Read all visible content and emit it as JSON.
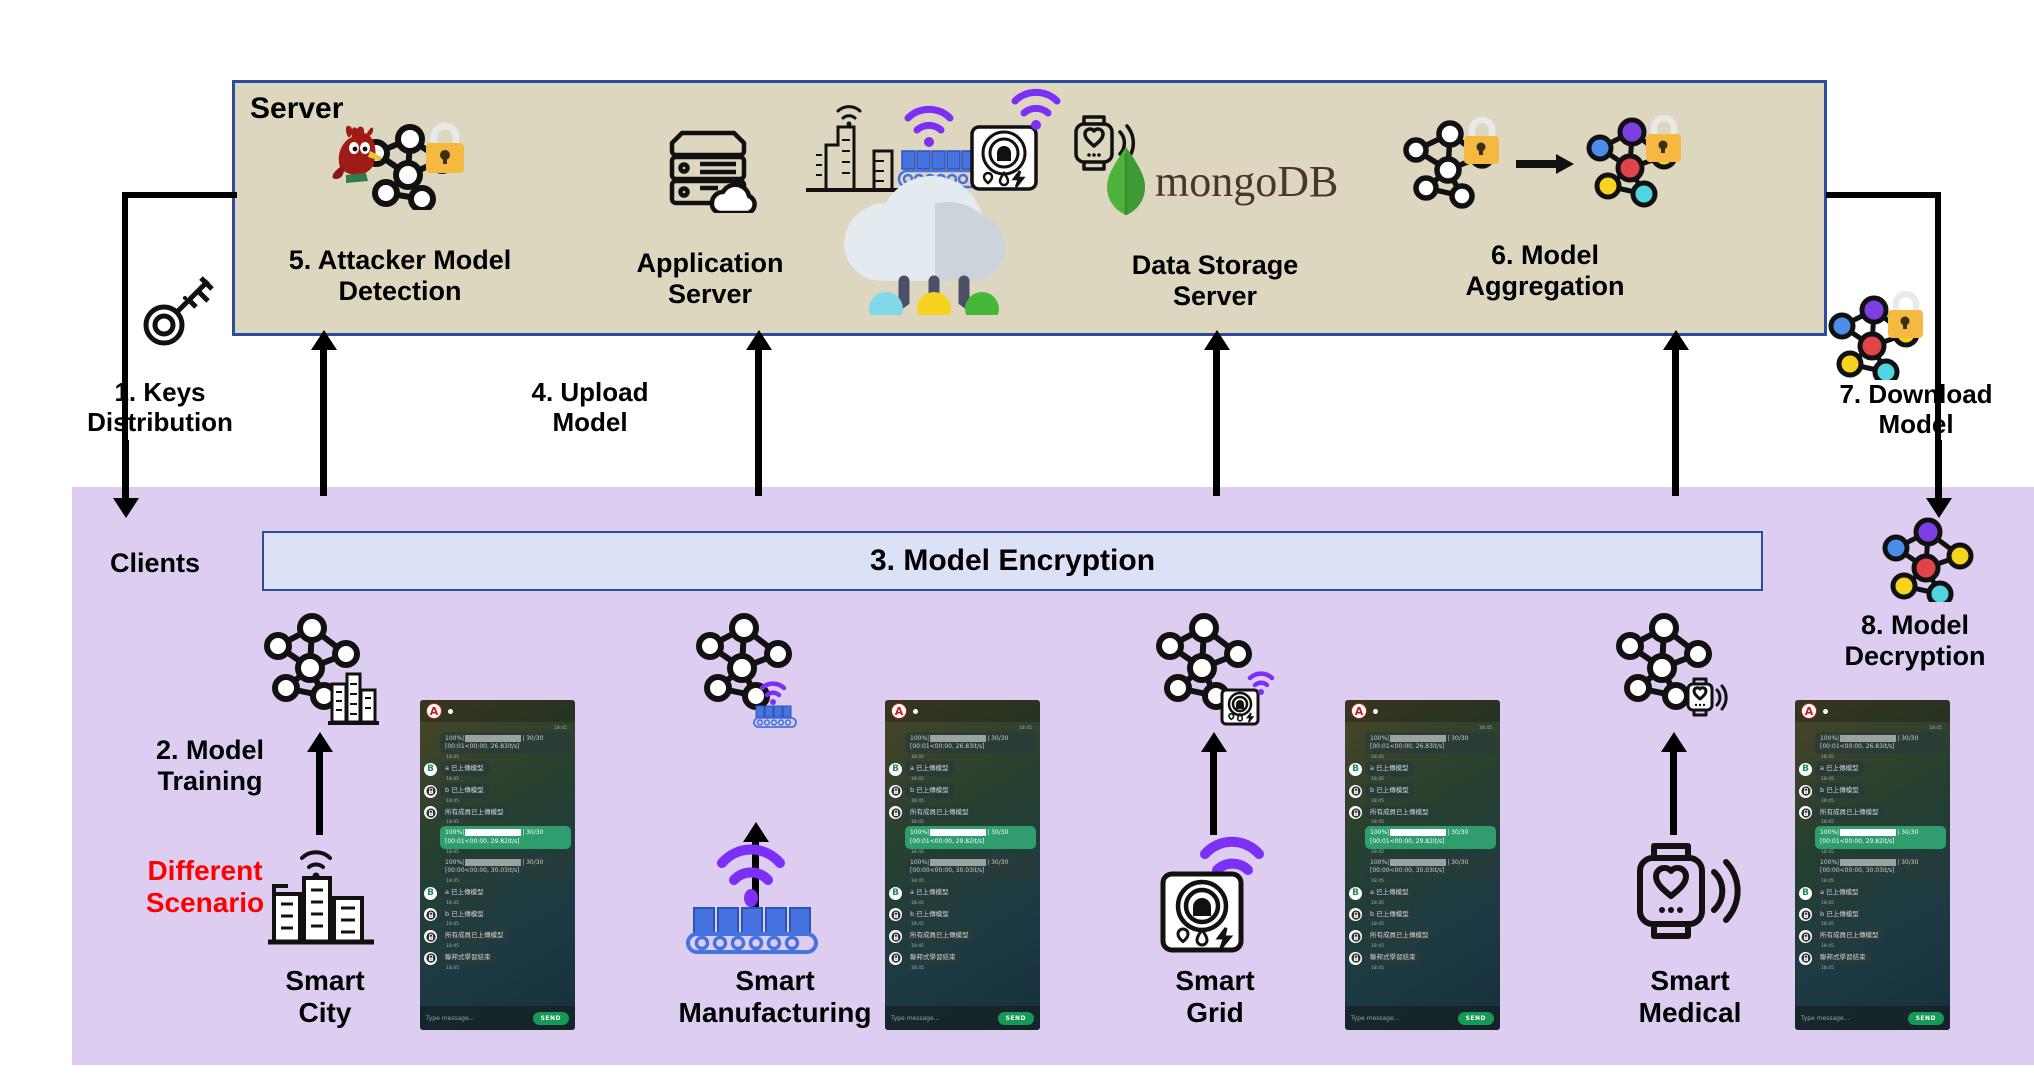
{
  "server": {
    "title": "Server",
    "panel_color": "#ddd7c0",
    "border_color": "#2f4b9b",
    "nodes": [
      {
        "id": "attacker-model-detection",
        "label": "5. Attacker Model\nDetection",
        "icon": "attacker-network-lock-icon"
      },
      {
        "id": "application-server",
        "label": "Application\nServer",
        "icon": "server-cloud-icon"
      },
      {
        "id": "iot-cloud",
        "label": "",
        "icon": "cloud-iot-devices-icon"
      },
      {
        "id": "data-storage-server",
        "label": "Data Storage\nServer",
        "icon": "mongodb-leaf-icon",
        "logo_text": "mongoDB"
      },
      {
        "id": "model-aggregation",
        "label": "6. Model\nAggregation",
        "icon": "network-aggregation-lock-icon"
      }
    ]
  },
  "clients": {
    "title": "Clients",
    "panel_color": "#ddcdf0",
    "encryption_bar": {
      "label": "3. Model Encryption",
      "bg": "#dbe1f7",
      "border": "#2f4b9b"
    },
    "model_training_label": "2. Model\nTraining",
    "different_scenario_label": "Different\nScenario",
    "different_scenario_color": "#ff0000",
    "scenarios": [
      {
        "id": "smart-city",
        "label": "Smart\nCity",
        "icon": "city-buildings-icon"
      },
      {
        "id": "smart-manufacturing",
        "label": "Smart\nManufacturing",
        "icon": "conveyor-belt-icon"
      },
      {
        "id": "smart-grid",
        "label": "Smart\nGrid",
        "icon": "smart-meter-icon"
      },
      {
        "id": "smart-medical",
        "label": "Smart\nMedical",
        "icon": "smartwatch-heart-icon"
      }
    ]
  },
  "flow_labels": {
    "keys_distribution": "1. Keys\nDistribution",
    "upload_model": "4. Upload\nModel",
    "download_model": "7. Download\nModel",
    "model_decryption": "8. Model\nDecryption"
  },
  "chat": {
    "header_avatar": "A",
    "peer_avatar": "B",
    "messages": [
      {
        "type": "progress",
        "text": "100%|",
        "suffix": "| 30/30 [00:01<00:00, 26.83it/s]",
        "style": "gray",
        "time": "18:45"
      },
      {
        "type": "text",
        "text": "a 已上傳模型",
        "time": "18:45"
      },
      {
        "type": "text",
        "text": "b 已上傳模型",
        "time": "18:45"
      },
      {
        "type": "text",
        "text": "所有成員已上傳模型",
        "time": "18:45"
      },
      {
        "type": "progress",
        "text": "100%|",
        "suffix": "| 30/30 [00:01<00:00, 29.82it/s]",
        "style": "green",
        "time": "18:45"
      },
      {
        "type": "progress",
        "text": "100%|",
        "suffix": "| 30/30 [00:00<00:00, 30.03it/s]",
        "style": "gray",
        "time": "18:45"
      },
      {
        "type": "text",
        "text": "a 已上傳模型",
        "time": "18:45"
      },
      {
        "type": "text",
        "text": "b 已上傳模型",
        "time": "18:45"
      },
      {
        "type": "text",
        "text": "所有成員已上傳模型",
        "time": "18:45"
      },
      {
        "type": "text",
        "text": "聯邦式學習結束",
        "time": "18:45"
      }
    ],
    "input_placeholder": "Type message...",
    "send_label": "SEND"
  }
}
